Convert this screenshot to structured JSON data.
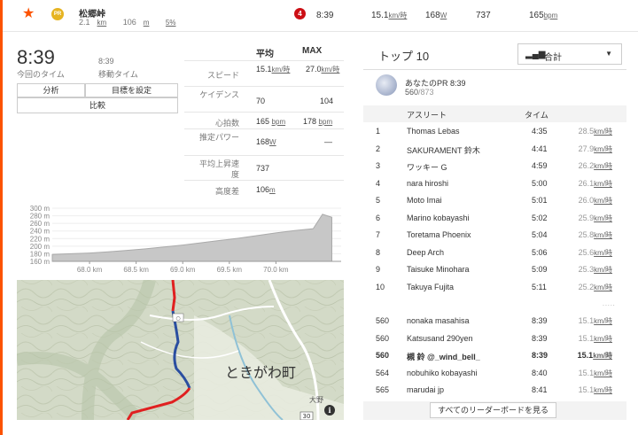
{
  "segment": {
    "name": "松郷峠",
    "distance": "2.1",
    "distance_unit": "km",
    "elevation": "106",
    "elevation_unit": "m",
    "grade": "5%",
    "rank_badge": "4",
    "time": "8:39",
    "speed": "15.1",
    "speed_unit": "km/時",
    "power": "168",
    "power_unit": "W",
    "energy": "737",
    "heartrate": "165",
    "heartrate_unit": "bpm"
  },
  "summary": {
    "time": "8:39",
    "time_label": "今回のタイム",
    "moving_time": "8:39",
    "moving_label": "移動タイム"
  },
  "buttons": {
    "analysis": "分析",
    "set_goal": "目標を設定",
    "compare": "比較"
  },
  "stats": {
    "avg_header": "平均",
    "max_header": "MAX",
    "rows": [
      {
        "label": "スピード",
        "avg": "15.1",
        "avg_unit": "km/時",
        "max": "27.0",
        "max_unit": "km/時"
      },
      {
        "label": "ケイデンス",
        "avg": "70",
        "avg_unit": "",
        "max": "104",
        "max_unit": ""
      },
      {
        "label": "心拍数",
        "avg": "165",
        "avg_unit": "bpm",
        "max": "178",
        "max_unit": "bpm"
      },
      {
        "label": "推定パワー",
        "avg": "168",
        "avg_unit": "W",
        "max": "—",
        "max_unit": ""
      },
      {
        "label": "平均上昇速度",
        "avg": "737",
        "avg_unit": "",
        "max": "",
        "max_unit": ""
      },
      {
        "label": "高度差",
        "avg": "106",
        "avg_unit": "m",
        "max": "",
        "max_unit": ""
      }
    ]
  },
  "chart_data": {
    "type": "area",
    "x": [
      67.6,
      67.8,
      68.0,
      68.2,
      68.4,
      68.6,
      68.8,
      69.0,
      69.2,
      69.4,
      69.6,
      69.8,
      70.0,
      70.2,
      70.4,
      70.5,
      70.6
    ],
    "y": [
      178,
      180,
      182,
      185,
      189,
      193,
      198,
      203,
      209,
      215,
      221,
      228,
      235,
      241,
      246,
      284,
      276
    ],
    "xticks": [
      "68.0 km",
      "68.5 km",
      "69.0 km",
      "69.5 km",
      "70.0 km"
    ],
    "xtick_values": [
      68.0,
      68.5,
      69.0,
      69.5,
      70.0
    ],
    "yticks": [
      "300 m",
      "280 m",
      "260 m",
      "240 m",
      "220 m",
      "200 m",
      "180 m",
      "160 m"
    ],
    "ytick_values": [
      300,
      280,
      260,
      240,
      220,
      200,
      180,
      160
    ],
    "xlim": [
      67.6,
      70.7
    ],
    "ylim": [
      160,
      300
    ],
    "grid": true,
    "fill_color": "#c7c7c7"
  },
  "map": {
    "town_label": "ときがわ町",
    "route_badge": "30",
    "route_badge_top": "大野"
  },
  "leaderboard": {
    "title": "トップ 10",
    "filter": "合計",
    "pr_label": "あなたのPR 8:39",
    "pr_rank": "560",
    "pr_total": "/873",
    "col_athlete": "アスリート",
    "col_time": "タイム",
    "rows": [
      {
        "rank": "1",
        "name": "Thomas Lebas",
        "time": "4:35",
        "speed": "28.5",
        "unit": "km/時"
      },
      {
        "rank": "2",
        "name": "SAKURAMENT 鈴木",
        "time": "4:41",
        "speed": "27.9",
        "unit": "km/時"
      },
      {
        "rank": "3",
        "name": "ワッキー G",
        "time": "4:59",
        "speed": "26.2",
        "unit": "km/時"
      },
      {
        "rank": "4",
        "name": "nara hiroshi",
        "time": "5:00",
        "speed": "26.1",
        "unit": "km/時"
      },
      {
        "rank": "5",
        "name": "Moto Imai",
        "time": "5:01",
        "speed": "26.0",
        "unit": "km/時"
      },
      {
        "rank": "6",
        "name": "Marino kobayashi",
        "time": "5:02",
        "speed": "25.9",
        "unit": "km/時"
      },
      {
        "rank": "7",
        "name": "Toretama Phoenix",
        "time": "5:04",
        "speed": "25.8",
        "unit": "km/時"
      },
      {
        "rank": "8",
        "name": "Deep Arch",
        "time": "5:06",
        "speed": "25.6",
        "unit": "km/時"
      },
      {
        "rank": "9",
        "name": "Taisuke Minohara",
        "time": "5:09",
        "speed": "25.3",
        "unit": "km/時"
      },
      {
        "rank": "10",
        "name": "Takuya Fujita",
        "time": "5:11",
        "speed": "25.2",
        "unit": "km/時"
      }
    ],
    "nearby": [
      {
        "rank": "560",
        "name": "nonaka masahisa",
        "time": "8:39",
        "speed": "15.1",
        "unit": "km/時"
      },
      {
        "rank": "560",
        "name": "Katsusand 290yen",
        "time": "8:39",
        "speed": "15.1",
        "unit": "km/時"
      },
      {
        "rank": "560",
        "name": "槻 鈴 @_wind_bell_",
        "time": "8:39",
        "speed": "15.1",
        "unit": "km/時"
      },
      {
        "rank": "564",
        "name": "nobuhiko kobayashi",
        "time": "8:40",
        "speed": "15.1",
        "unit": "km/時"
      },
      {
        "rank": "565",
        "name": "marudai jp",
        "time": "8:41",
        "speed": "15.1",
        "unit": "km/時"
      }
    ],
    "ellipsis": ".....",
    "see_all": "すべてのリーダーボードを見る"
  }
}
